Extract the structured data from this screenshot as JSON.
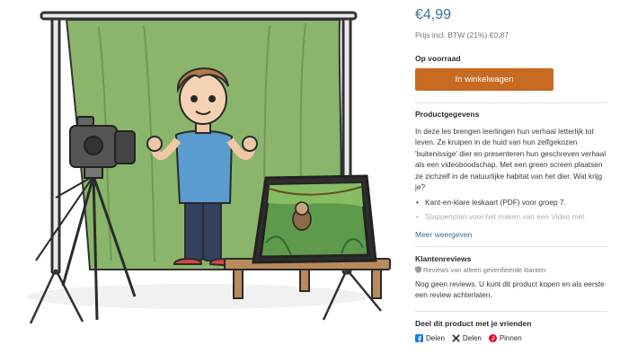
{
  "illustration": {
    "description_icons": [
      "green-screen",
      "boy",
      "camera-on-tripod",
      "tablet-with-sloth",
      "table"
    ]
  },
  "product": {
    "price": "€4,99",
    "vat_note": "Prijs incl. BTW (21%) €0,87",
    "stock": "Op voorraad",
    "cart_button": "In winkelwagen"
  },
  "details": {
    "heading": "Productgegevens",
    "description": "In deze les brengen leerlingen hun verhaal letterlijk tot leven. Ze kruipen in de huid van hun zelfgekozen 'buitenissige' dier en presenteren hun geschreven verhaal als een videoboodschap. Met een green screen plaatsen ze zichzelf in de natuurlijke habitat van het dier. Wat krijg je?",
    "bullets": [
      "Kant-en-klare leskaart (PDF) voor groep 7.",
      "Stappenplan voor het maken van een Video met"
    ],
    "more": "Meer weergeven"
  },
  "reviews": {
    "heading": "Klantenreviews",
    "note": "Reviews van alleen geverifieerde klanten",
    "empty": "Nog geen reviews. U kunt dit product kopen en als eerste een review achterlaten."
  },
  "share": {
    "heading": "Deel dit product met je vrienden",
    "facebook": "Delen",
    "x": "Delen",
    "pinterest": "Pinnen",
    "colors": {
      "facebook": "#1877f2",
      "x": "#111111",
      "pinterest": "#e60023"
    }
  },
  "colors": {
    "price": "#3a6f96",
    "button": "#c96a22",
    "link": "#3a6f96"
  }
}
